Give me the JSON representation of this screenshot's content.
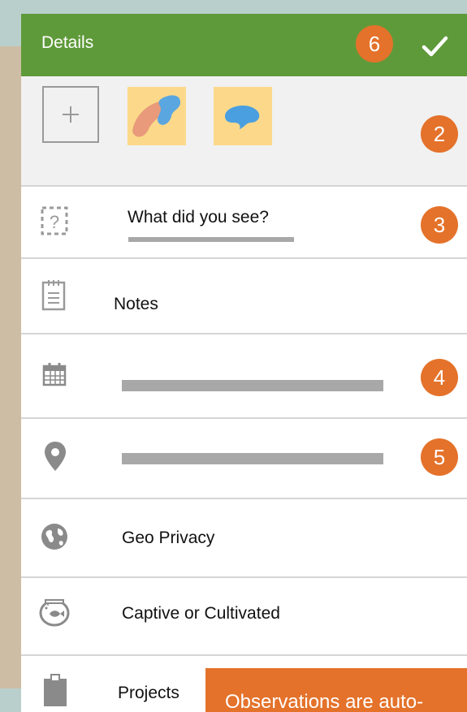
{
  "header": {
    "title": "Details",
    "check_icon": "checkmark-icon"
  },
  "badges": {
    "photos": "2",
    "species": "3",
    "date": "4",
    "location": "5",
    "save": "6"
  },
  "photos": {
    "add_icon": "plus-icon"
  },
  "fields": {
    "species": {
      "label": "What did you see?",
      "icon": "unknown-species-icon"
    },
    "notes": {
      "label": "Notes",
      "icon": "notepad-icon"
    },
    "date": {
      "icon": "calendar-icon"
    },
    "location": {
      "icon": "map-pin-icon"
    },
    "geo_privacy": {
      "label": "Geo Privacy",
      "icon": "globe-icon"
    },
    "captive": {
      "label": "Captive or Cultivated",
      "icon": "fishbowl-icon"
    },
    "projects": {
      "label": "Projects",
      "icon": "clipboard-icon"
    }
  },
  "toast": {
    "text": "Observations are auto-"
  },
  "colors": {
    "header": "#5f9a3a",
    "badge": "#e4722a",
    "placeholder_bar": "#a8a8a8",
    "thumb_bg": "#fcd98a"
  }
}
